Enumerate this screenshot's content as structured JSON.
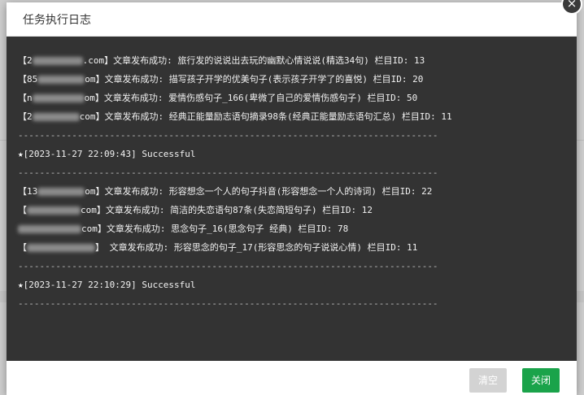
{
  "modal": {
    "title": "任务执行日志",
    "close_icon": "close-icon",
    "close_glyph": "×"
  },
  "colors": {
    "console_bg": "#333333",
    "primary_button": "#1aa34a",
    "disabled_button": "#d3d3d3"
  },
  "log": {
    "separator": "------------------------------------------------------------------------------",
    "star_icon": "star-icon",
    "star_glyph": "★",
    "entries": [
      {
        "prefix": "【2",
        "suffix": ".com】",
        "msg": "文章发布成功: 旅行发的说说出去玩的幽默心情说说(精选34句) 栏目ID: 13"
      },
      {
        "prefix": "【85",
        "suffix": "om】",
        "msg": "文章发布成功: 描写孩子开学的优美句子(表示孩子开学了的喜悦) 栏目ID: 20"
      },
      {
        "prefix": "【n",
        "suffix": "om】",
        "msg": "文章发布成功: 爱情伤感句子_166(卑微了自己的爱情伤感句子) 栏目ID: 50"
      },
      {
        "prefix": "【2",
        "suffix": "com】",
        "msg": "文章发布成功: 经典正能量励志语句摘录98条(经典正能量励志语句汇总) 栏目ID: 11"
      }
    ],
    "entries2": [
      {
        "prefix": "【13",
        "suffix": "om】",
        "msg": "文章发布成功: 形容想念一个人的句子抖音(形容想念一个人的诗词) 栏目ID: 22"
      },
      {
        "prefix": "【",
        "suffix": "com】",
        "msg": "文章发布成功: 简洁的失恋语句87条(失恋简短句子) 栏目ID: 12"
      },
      {
        "prefix": "",
        "suffix": "com】",
        "msg": "文章发布成功: 思念句子_16(思念句子 经典) 栏目ID: 78"
      },
      {
        "prefix": "【",
        "suffix": "】",
        "msg": " 文章发布成功: 形容思念的句子_17(形容思念的句子说说心情) 栏目ID: 11"
      }
    ],
    "status1": "[2023-11-27 22:09:43] Successful",
    "status2": "[2023-11-27 22:10:29] Successful"
  },
  "footer": {
    "clear_label": "清空",
    "close_label": "关闭"
  }
}
